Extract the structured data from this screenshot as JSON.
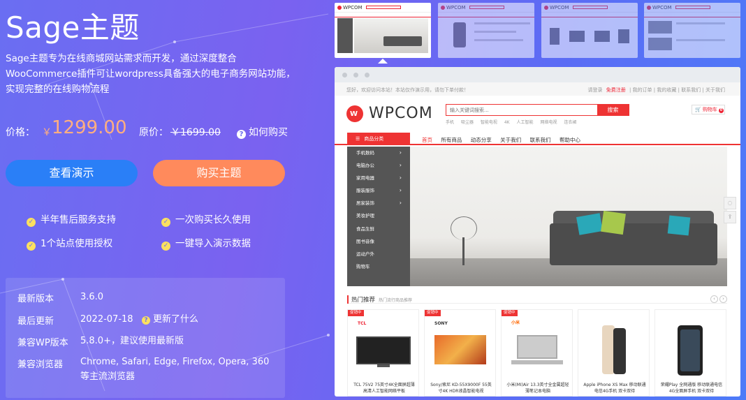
{
  "product": {
    "title": "Sage主题",
    "description": "Sage主题专为在线商城网站需求而开发，通过深度整合WooCommerce插件可让wordpress具备强大的电子商务网站功能，实现完整的在线购物流程"
  },
  "price": {
    "label": "价格：",
    "currency": "￥",
    "amount": "1299.00",
    "original_label": "原价：",
    "original_amount": "￥1699.00",
    "how_to_buy": "如何购买"
  },
  "buttons": {
    "demo": "查看演示",
    "buy": "购买主题"
  },
  "features": [
    "半年售后服务支持",
    "一次购买长久使用",
    "1个站点使用授权",
    "一键导入演示数据"
  ],
  "info": {
    "version_label": "最新版本",
    "version": "3.6.0",
    "updated_label": "最后更新",
    "updated": "2022-07-18",
    "whats_new": "更新了什么",
    "wp_label": "兼容WP版本",
    "wp": "5.8.0+，建议使用最新版",
    "browser_label": "兼容浏览器",
    "browser": "Chrome, Safari, Edge, Firefox, Opera, 360等主流浏览器"
  },
  "colors": {
    "accent_blue": "#2a7ff7",
    "accent_orange": "#ff8a5c",
    "price_color": "#ffae80",
    "brand_red": "#ee3333"
  },
  "preview": {
    "logo_text": "WPCOM",
    "topnav_left": "您好，欢迎访问本站！本站仅作演示用，请勿下单付款！",
    "topnav_links": [
      "请登录",
      "免费注册",
      "我的订单",
      "我的收藏",
      "联系我们",
      "关于我们"
    ],
    "search_placeholder": "输入关键词搜索...",
    "search_button": "搜索",
    "hot_words": [
      "手机",
      "吸尘器",
      "智能电视",
      "4K",
      "人工智能",
      "网络电视",
      "连衣裙"
    ],
    "cart": "购物车",
    "cart_count": "0",
    "category_button": "商品分类",
    "nav": [
      "首页",
      "所有商品",
      "动态分享",
      "关于我们",
      "联系我们",
      "帮助中心"
    ],
    "categories": [
      "手机数码",
      "电脑办公",
      "家用电器",
      "服装服饰",
      "居家装饰",
      "美妆护理",
      "食品生鲜",
      "图书音像",
      "运动户外",
      "购物车"
    ],
    "hot_title": "热门推荐",
    "hot_sub": "热门流行商品推荐",
    "products": [
      {
        "tag": "促销中",
        "brand": "TCL",
        "name": "TCL 75V2 75英寸4K全面屏超薄高清人工智能网络平板"
      },
      {
        "tag": "促销中",
        "brand": "SONY",
        "name": "Sony/索尼 KD-55X9000F 55英寸4K HDR液晶智能电视"
      },
      {
        "tag": "促销中",
        "brand": "小米",
        "name": "小米(MI)Air 13.3英寸全金属超轻薄笔记本电脑"
      },
      {
        "tag": "",
        "brand": "",
        "name": "Apple iPhone XS Max 移动联通电信4G手机 双卡双待"
      },
      {
        "tag": "",
        "brand": "",
        "name": "荣耀Play 全网通版 移动联通电信4G全面屏手机 双卡双待"
      }
    ]
  },
  "thumbs": [
    "thumb-home",
    "thumb-phone",
    "thumb-products",
    "thumb-list"
  ]
}
